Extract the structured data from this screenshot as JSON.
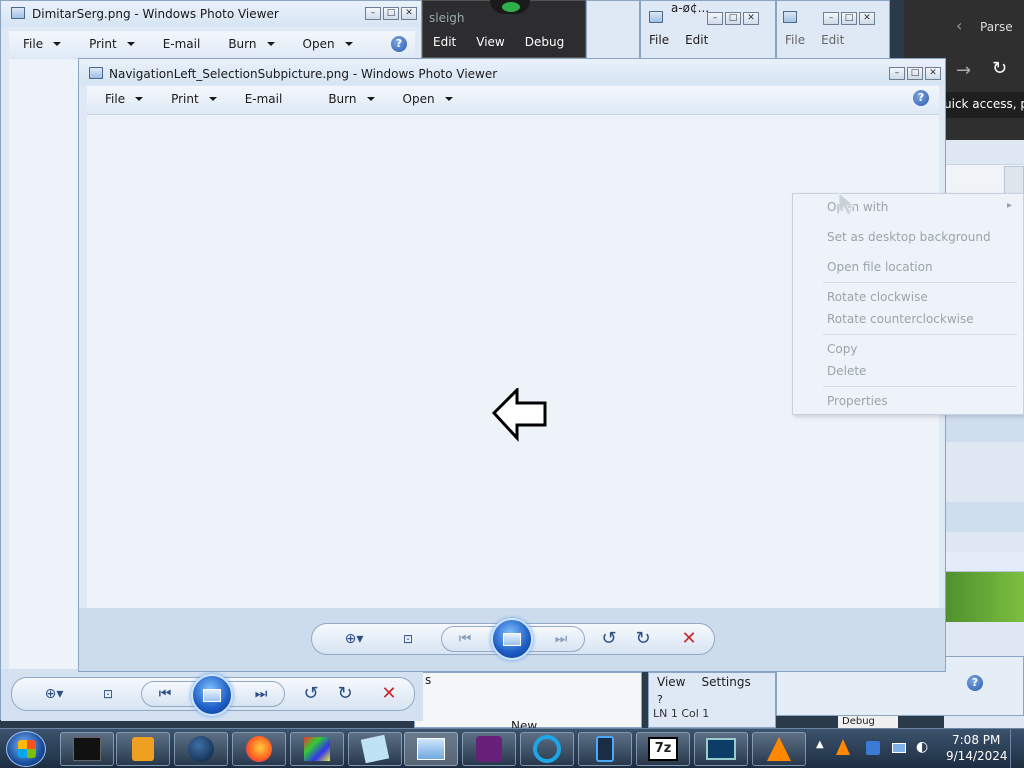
{
  "background_window": {
    "title": "DimitarSerg.png - Windows Photo Viewer",
    "menu": [
      {
        "label": "File",
        "dropdown": true
      },
      {
        "label": "Print",
        "dropdown": true
      },
      {
        "label": "E-mail",
        "dropdown": false
      },
      {
        "label": "Burn",
        "dropdown": true
      },
      {
        "label": "Open",
        "dropdown": true
      }
    ],
    "help_label": "?"
  },
  "main_window": {
    "title": "NavigationLeft_SelectionSubpicture.png - Windows Photo Viewer",
    "menu": [
      {
        "label": "File",
        "dropdown": true
      },
      {
        "label": "Print",
        "dropdown": true
      },
      {
        "label": "E-mail",
        "dropdown": false
      },
      {
        "label": "Burn",
        "dropdown": true
      },
      {
        "label": "Open",
        "dropdown": true
      }
    ],
    "help_label": "?",
    "canvas_color": "#eef3fa",
    "accent": "#2a5bb0"
  },
  "other_windows": {
    "editor_menu": [
      "Edit",
      "View",
      "Debug"
    ],
    "editor_title_fragment": "sleigh",
    "small_win_title": "a-ø¢...",
    "small_win_menu": [
      "File",
      "Edit"
    ],
    "small_win2_menu": [
      "File",
      "Edit"
    ],
    "right_panel_text": "Parse",
    "right_panel_address": "uick access, pla",
    "bottom_menu": [
      "View",
      "Settings"
    ],
    "bottom_q": "?",
    "bottom_truncated": "LN 1  Col 1",
    "bottom_new": "New",
    "bottom_s": "s",
    "debug_tab": "Debug"
  },
  "context_menu": {
    "items": [
      {
        "label": "Open with",
        "has_submenu": true
      },
      {
        "label": "Set as desktop background"
      },
      {
        "label": "Open file location"
      },
      {
        "label": "Rotate clockwise"
      },
      {
        "label": "Rotate counterclockwise"
      },
      {
        "label": "Copy"
      },
      {
        "label": "Delete"
      },
      {
        "label": "Properties"
      }
    ]
  },
  "taskbar": {
    "time": "7:08 PM",
    "date": "9/14/2024",
    "apps": [
      "terminal-icon",
      "media-player-icon",
      "globe-icon",
      "firefox-icon",
      "paint-icon",
      "notes-icon",
      "photo-viewer-icon",
      "visual-studio-icon",
      "internet-explorer-icon",
      "tablet-icon",
      "7zip-icon",
      "remote-desktop-icon",
      "vlc-icon"
    ]
  }
}
